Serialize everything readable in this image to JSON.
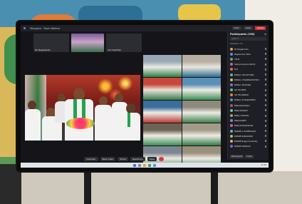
{
  "meeting": {
    "window_title": "Telangana · Zoom Webinar",
    "top_buttons": [
      "View",
      "Apps",
      "Leave"
    ],
    "thumbnails": [
      {
        "label": "RV Nagabandu",
        "type": "dark"
      },
      {
        "label": "",
        "type": "video"
      },
      {
        "label": "mk.manthak",
        "type": "dark"
      }
    ],
    "grid_cells": [
      {
        "label": "",
        "colors": [
          "#9aa7b4",
          "#ecebe6",
          "#2f7d47"
        ]
      },
      {
        "label": "",
        "colors": [
          "#b7b0a2",
          "#e9e6df",
          "#2d6f8f"
        ]
      },
      {
        "label": "",
        "colors": [
          "#c7473a",
          "#e7e2d8",
          "#3a7b4a"
        ]
      },
      {
        "label": "",
        "colors": [
          "#5a8fb8",
          "#efece4",
          "#3e8d56"
        ]
      },
      {
        "label": "",
        "colors": [
          "#3c6e9a",
          "#efeee8",
          "#b83a32"
        ]
      },
      {
        "label": "",
        "colors": [
          "#8f8a7e",
          "#ecebe4",
          "#3d7f4a"
        ]
      },
      {
        "label": "",
        "colors": [
          "#6b6356",
          "#f0ede5",
          "#3a8e52"
        ]
      },
      {
        "label": "",
        "colors": [
          "#a39a8a",
          "#efece3",
          "#2f7a46"
        ]
      },
      {
        "label": "",
        "colors": [
          "#7d8690",
          "#ebe9e2",
          "#3a7d4c"
        ]
      },
      {
        "label": "",
        "colors": [
          "#9b8f7d",
          "#edeae2",
          "#34824e"
        ]
      },
      {
        "label": "",
        "colors": [
          "#6f7a84",
          "#f1efe8",
          "#2e7544"
        ]
      },
      {
        "label": "",
        "colors": [
          "#8c8170",
          "#eeebe3",
          "#3b854f"
        ]
      }
    ],
    "participants": {
      "title": "Participants (198)",
      "search_placeholder": "Search",
      "section": "Speakers (3)",
      "items": [
        {
          "name": "RV Nagabandu",
          "color": "#e0a43a"
        },
        {
          "name": "Nagasurkar Attar",
          "color": "#5b8def"
        },
        {
          "name": "VFLM",
          "color": "#58b368"
        },
        {
          "name": "Satyanarayana Reddy",
          "color": "#c45bd0"
        },
        {
          "name": "B.N",
          "color": "#e06a4a"
        },
        {
          "name": "BRNK-1 HN SATYABA",
          "color": "#4ab3c4"
        },
        {
          "name": "BRNK-1 CHANDRAMOHAN",
          "color": "#d4c04a"
        },
        {
          "name": "BRNK-1 MAHARAJ",
          "color": "#8a6ae0"
        },
        {
          "name": "GR HN PRIM",
          "color": "#5bc47a"
        },
        {
          "name": "GR HN ANNIAH",
          "color": "#e0863a"
        },
        {
          "name": "BRNK-1 M NARASIMHA",
          "color": "#4a8fe0"
        },
        {
          "name": "BNRJ NAGARAJU",
          "color": "#c44a6a"
        },
        {
          "name": "BNRJ SRIKANT",
          "color": "#6ac4b0"
        },
        {
          "name": "BNRJ-1 MOHAN",
          "color": "#b0a45b"
        },
        {
          "name": "BNRJ RAJEEV",
          "color": "#7a8ae0"
        },
        {
          "name": "BNRJ SOMASEKHAR",
          "color": "#e05b8a"
        },
        {
          "name": "BRNNE A HARIPRASAD",
          "color": "#5bb0e0"
        },
        {
          "name": "BRNNE RAMAKRISH",
          "color": "#a0c45b"
        },
        {
          "name": "BRNNE Nagendra Reddy",
          "color": "#e0b05b"
        },
        {
          "name": "BRNNE SRINIVAS",
          "color": "#8a5be0"
        }
      ],
      "footer_buttons": [
        "Participants",
        "Invite"
      ]
    },
    "toolbar": [
      "Calendar",
      "Best video",
      "Share",
      "Reactions",
      "Apps"
    ],
    "taskbar_time": "11:24"
  }
}
